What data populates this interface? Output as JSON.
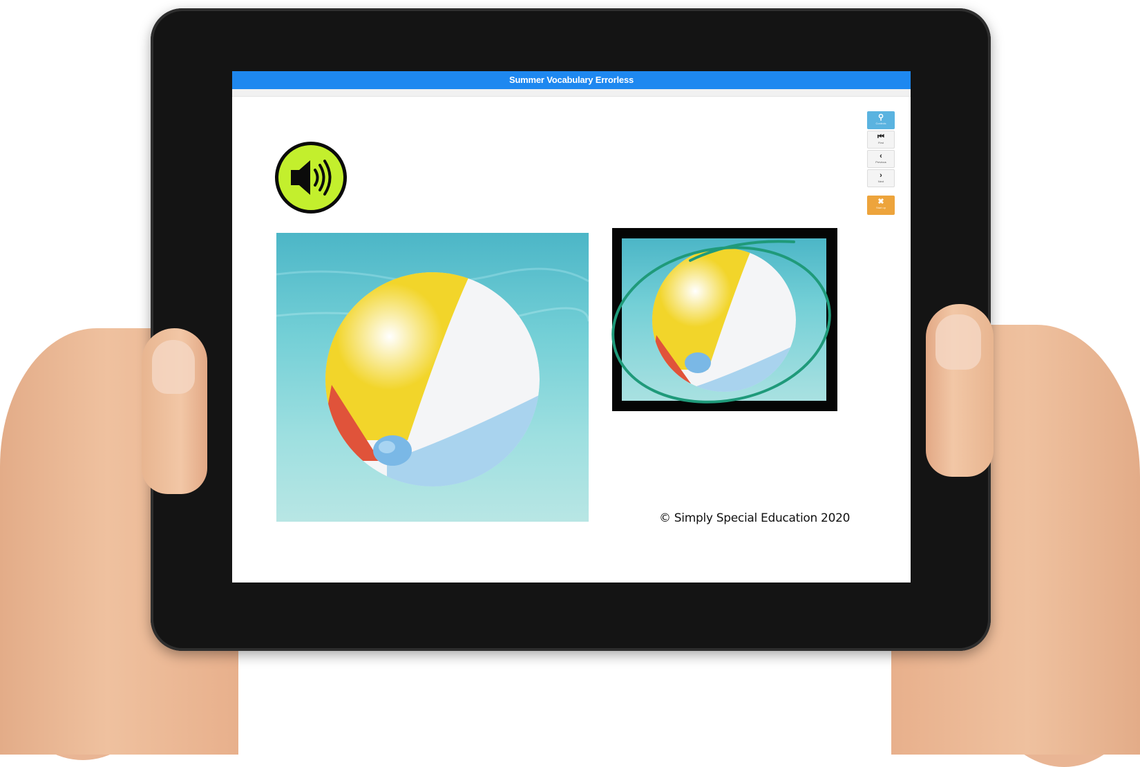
{
  "app": {
    "title": "Summer Vocabulary Errorless"
  },
  "audio": {
    "icon": "speaker-icon"
  },
  "images": {
    "main": {
      "subject": "beach-ball"
    },
    "choice": {
      "subject": "beach-ball",
      "selected": true
    }
  },
  "nav": {
    "search": {
      "icon": "search-icon",
      "label": "Controls"
    },
    "first": {
      "icon": "first-icon",
      "label": "First"
    },
    "previous": {
      "icon": "previous-icon",
      "label": "Previous"
    },
    "next": {
      "icon": "next-icon",
      "label": "Next"
    },
    "close": {
      "icon": "close-icon",
      "label": "Start up"
    }
  },
  "footer": {
    "copyright": "© Simply Special Education 2020"
  },
  "colors": {
    "title_bar": "#1e88f0",
    "speaker_bg": "#c3ef2d",
    "selection_circle": "#1f9a7a",
    "close_button": "#eda43c",
    "search_button": "#5ab3e0"
  }
}
